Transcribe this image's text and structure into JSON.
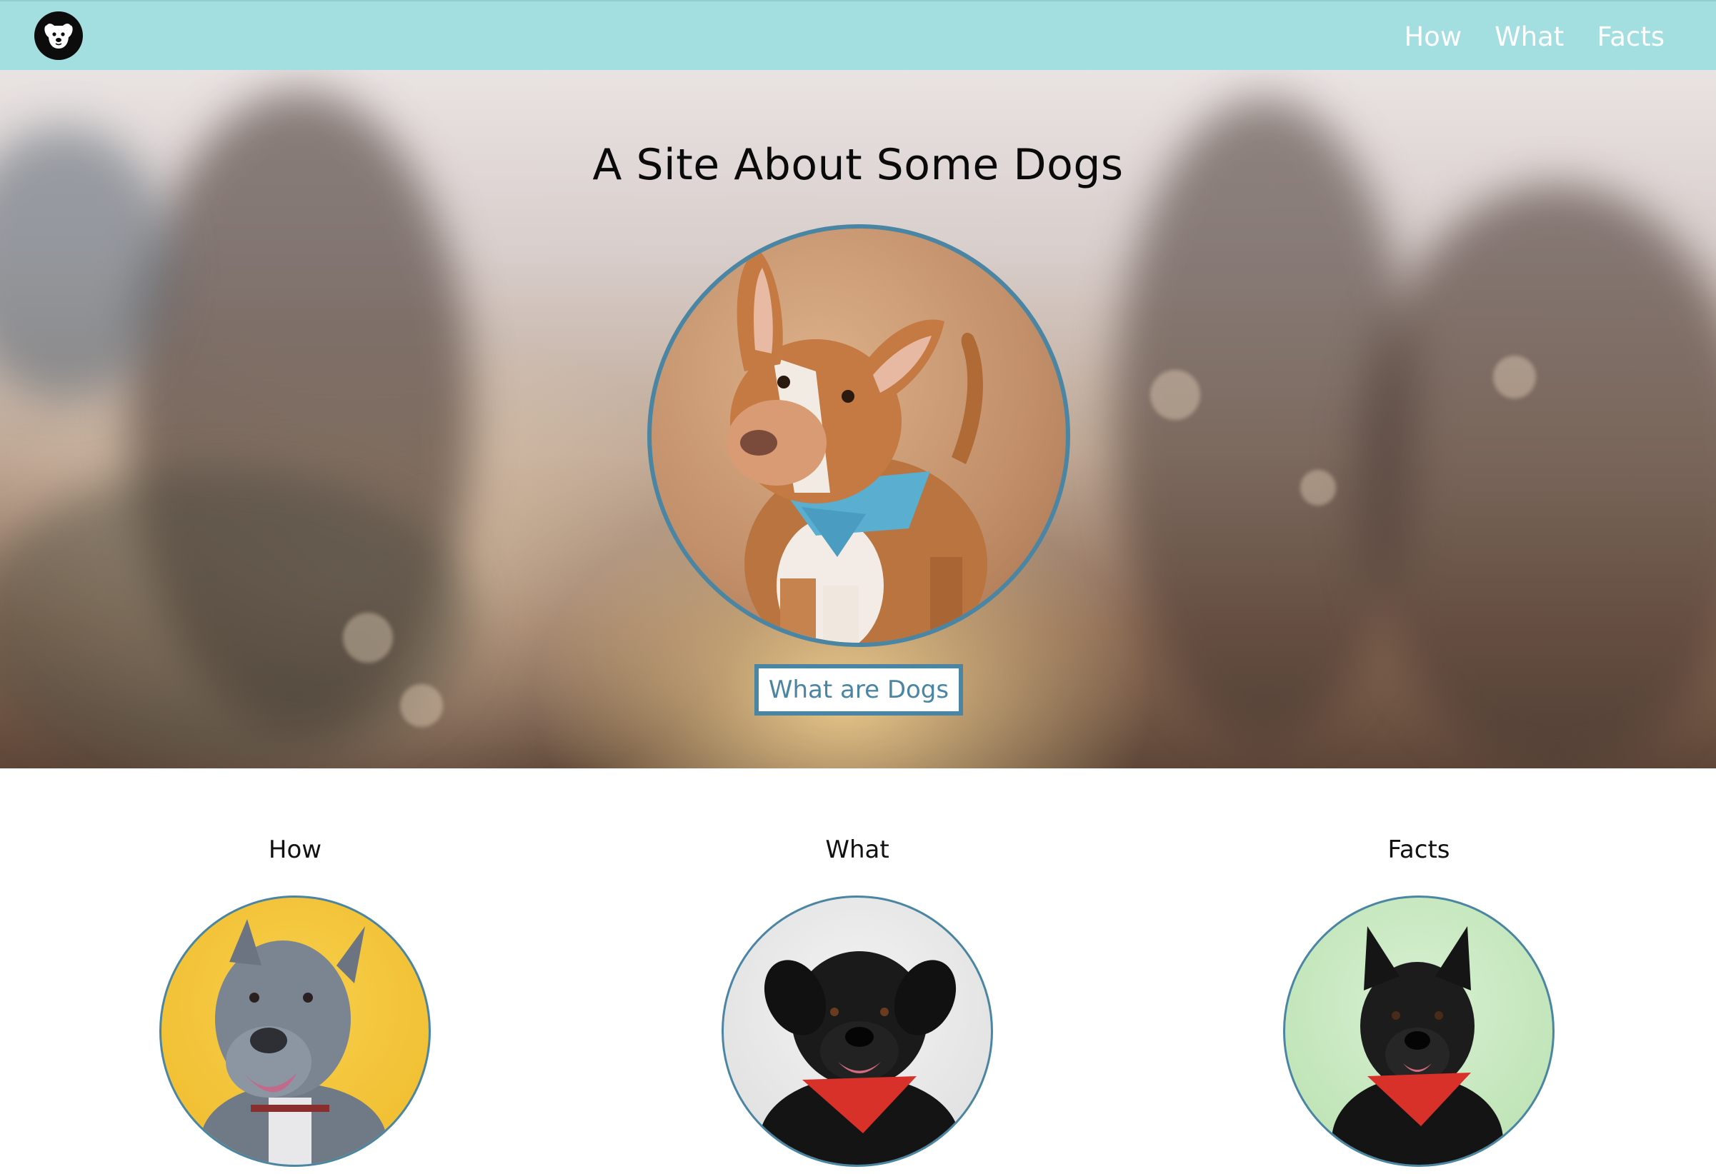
{
  "nav": {
    "logo_icon": "dog-face-icon",
    "links": [
      "How",
      "What",
      "Facts"
    ]
  },
  "hero": {
    "title": "A Site About Some Dogs",
    "cta_label": "What are Dogs",
    "photo": "brown-white-dog-photo"
  },
  "sections": [
    {
      "title": "How",
      "photo": "grey-dog-photo",
      "bg": "#f2c237"
    },
    {
      "title": "What",
      "photo": "black-dog-photo",
      "bg": "#e6e6e6"
    },
    {
      "title": "Facts",
      "photo": "black-shepherd-dog-photo",
      "bg": "#bfe3b8"
    }
  ],
  "colors": {
    "nav_bg": "#a3dfe1",
    "accent": "#4a86a3",
    "text": "#0a0a0a"
  }
}
